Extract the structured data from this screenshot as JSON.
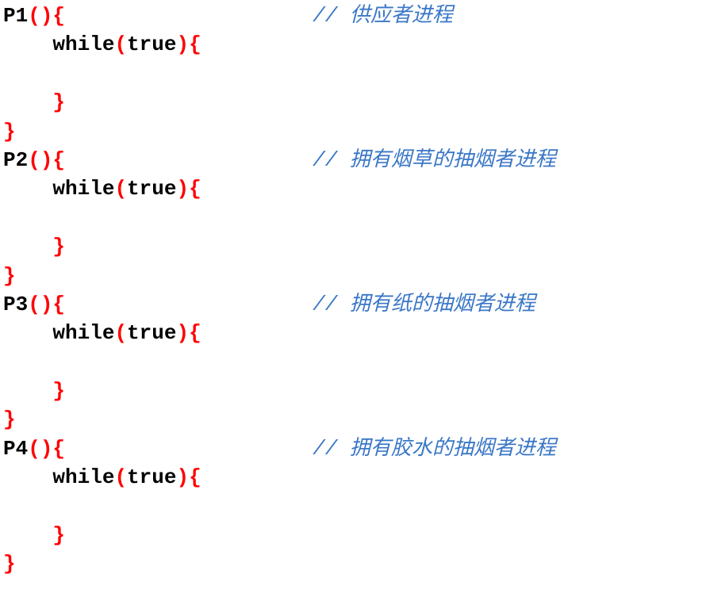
{
  "code": {
    "lines": [
      {
        "tokens": [
          {
            "text": "P1",
            "cls": "tok-black"
          },
          {
            "text": "(){",
            "cls": "tok-red"
          },
          {
            "text": "                    ",
            "cls": "tok-black"
          },
          {
            "text": "// 供应者进程",
            "cls": "tok-blue"
          }
        ]
      },
      {
        "tokens": [
          {
            "text": "    ",
            "cls": "tok-black"
          },
          {
            "text": "while",
            "cls": "tok-black"
          },
          {
            "text": "(",
            "cls": "tok-red"
          },
          {
            "text": "true",
            "cls": "tok-black"
          },
          {
            "text": "){",
            "cls": "tok-red"
          }
        ]
      },
      {
        "tokens": [
          {
            "text": " ",
            "cls": "tok-black"
          }
        ]
      },
      {
        "tokens": [
          {
            "text": "    ",
            "cls": "tok-black"
          },
          {
            "text": "}",
            "cls": "tok-red"
          }
        ]
      },
      {
        "tokens": [
          {
            "text": "}",
            "cls": "tok-red"
          }
        ]
      },
      {
        "tokens": [
          {
            "text": "P2",
            "cls": "tok-black"
          },
          {
            "text": "(){",
            "cls": "tok-red"
          },
          {
            "text": "                    ",
            "cls": "tok-black"
          },
          {
            "text": "// 拥有烟草的抽烟者进程",
            "cls": "tok-blue"
          }
        ]
      },
      {
        "tokens": [
          {
            "text": "    ",
            "cls": "tok-black"
          },
          {
            "text": "while",
            "cls": "tok-black"
          },
          {
            "text": "(",
            "cls": "tok-red"
          },
          {
            "text": "true",
            "cls": "tok-black"
          },
          {
            "text": "){",
            "cls": "tok-red"
          }
        ]
      },
      {
        "tokens": [
          {
            "text": " ",
            "cls": "tok-black"
          }
        ]
      },
      {
        "tokens": [
          {
            "text": "    ",
            "cls": "tok-black"
          },
          {
            "text": "}",
            "cls": "tok-red"
          }
        ]
      },
      {
        "tokens": [
          {
            "text": "}",
            "cls": "tok-red"
          }
        ]
      },
      {
        "tokens": [
          {
            "text": "P3",
            "cls": "tok-black"
          },
          {
            "text": "(){",
            "cls": "tok-red"
          },
          {
            "text": "                    ",
            "cls": "tok-black"
          },
          {
            "text": "// 拥有纸的抽烟者进程",
            "cls": "tok-blue"
          }
        ]
      },
      {
        "tokens": [
          {
            "text": "    ",
            "cls": "tok-black"
          },
          {
            "text": "while",
            "cls": "tok-black"
          },
          {
            "text": "(",
            "cls": "tok-red"
          },
          {
            "text": "true",
            "cls": "tok-black"
          },
          {
            "text": "){",
            "cls": "tok-red"
          }
        ]
      },
      {
        "tokens": [
          {
            "text": " ",
            "cls": "tok-black"
          }
        ]
      },
      {
        "tokens": [
          {
            "text": "    ",
            "cls": "tok-black"
          },
          {
            "text": "}",
            "cls": "tok-red"
          }
        ]
      },
      {
        "tokens": [
          {
            "text": "}",
            "cls": "tok-red"
          }
        ]
      },
      {
        "tokens": [
          {
            "text": "P4",
            "cls": "tok-black"
          },
          {
            "text": "(){",
            "cls": "tok-red"
          },
          {
            "text": "                    ",
            "cls": "tok-black"
          },
          {
            "text": "// 拥有胶水的抽烟者进程",
            "cls": "tok-blue"
          }
        ]
      },
      {
        "tokens": [
          {
            "text": "    ",
            "cls": "tok-black"
          },
          {
            "text": "while",
            "cls": "tok-black"
          },
          {
            "text": "(",
            "cls": "tok-red"
          },
          {
            "text": "true",
            "cls": "tok-black"
          },
          {
            "text": "){",
            "cls": "tok-red"
          }
        ]
      },
      {
        "tokens": [
          {
            "text": " ",
            "cls": "tok-black"
          }
        ]
      },
      {
        "tokens": [
          {
            "text": "    ",
            "cls": "tok-black"
          },
          {
            "text": "}",
            "cls": "tok-red"
          }
        ]
      },
      {
        "tokens": [
          {
            "text": "}",
            "cls": "tok-red"
          }
        ]
      }
    ]
  }
}
